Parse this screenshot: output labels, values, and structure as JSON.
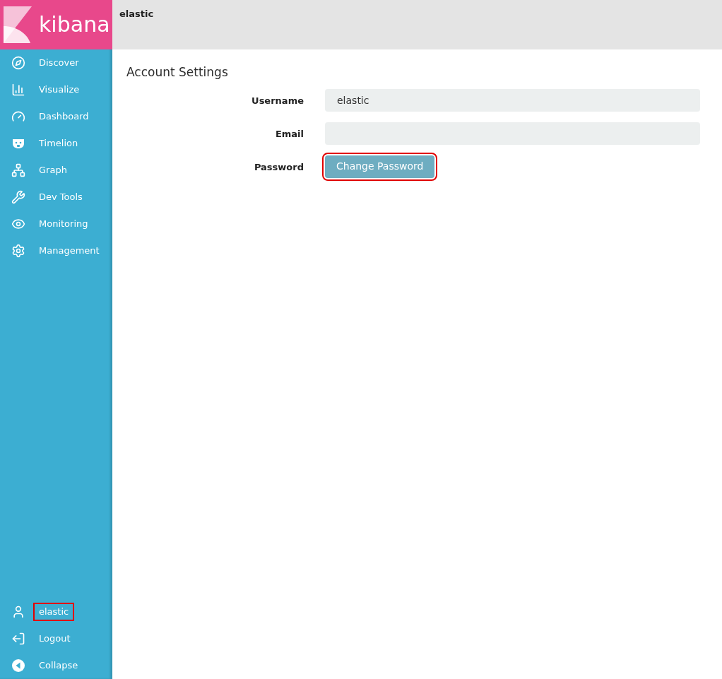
{
  "sidebar": {
    "logo": "kibana",
    "items": [
      {
        "label": "Discover"
      },
      {
        "label": "Visualize"
      },
      {
        "label": "Dashboard"
      },
      {
        "label": "Timelion"
      },
      {
        "label": "Graph"
      },
      {
        "label": "Dev Tools"
      },
      {
        "label": "Monitoring"
      },
      {
        "label": "Management"
      }
    ],
    "bottom_items": [
      {
        "label": "elastic",
        "highlighted": true
      },
      {
        "label": "Logout",
        "highlighted": false
      },
      {
        "label": "Collapse",
        "highlighted": false
      }
    ]
  },
  "header": {
    "title": "elastic"
  },
  "account_settings": {
    "title": "Account Settings",
    "fields": [
      {
        "kind": "input",
        "label": "Username",
        "value": "elastic"
      },
      {
        "kind": "input",
        "label": "Email"
      },
      {
        "kind": "button",
        "label": "Password",
        "button": "Change Password",
        "highlighted": true
      }
    ]
  }
}
